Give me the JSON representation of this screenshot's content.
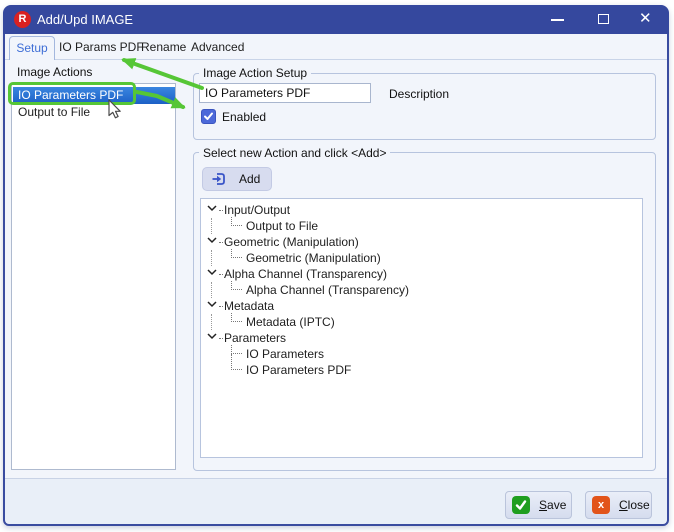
{
  "window": {
    "title": "Add/Upd IMAGE",
    "logo_letter": "R",
    "close_glyph": "✕"
  },
  "tabs": [
    {
      "label": "Setup",
      "active": true
    },
    {
      "label": "IO Params PDF",
      "active": false
    },
    {
      "label": "Rename",
      "active": false
    },
    {
      "label": "Advanced",
      "active": false
    }
  ],
  "left_panel": {
    "title": "Image Actions",
    "items": [
      {
        "label": "IO Parameters PDF",
        "selected": true
      },
      {
        "label": "Output to File",
        "selected": false
      }
    ]
  },
  "action_setup": {
    "group_title": "Image Action Setup",
    "name_value": "IO Parameters PDF",
    "description_label": "Description",
    "enabled_label": "Enabled",
    "enabled_checked": true
  },
  "add_section": {
    "group_title": "Select new Action  and click <Add>",
    "add_button_label": "Add",
    "tree": [
      {
        "label": "Input/Output",
        "type": "parent"
      },
      {
        "label": "Output to File",
        "type": "child"
      },
      {
        "label": "Geometric (Manipulation)",
        "type": "parent"
      },
      {
        "label": "Geometric (Manipulation)",
        "type": "child"
      },
      {
        "label": "Alpha Channel (Transparency)",
        "type": "parent"
      },
      {
        "label": "Alpha Channel (Transparency)",
        "type": "child"
      },
      {
        "label": "Metadata",
        "type": "parent"
      },
      {
        "label": "Metadata (IPTC)",
        "type": "child"
      },
      {
        "label": "Parameters",
        "type": "parent"
      },
      {
        "label": "IO Parameters",
        "type": "child-middle"
      },
      {
        "label": "IO Parameters PDF",
        "type": "child-last"
      }
    ]
  },
  "footer": {
    "save_label": "Save",
    "close_label": "Close"
  },
  "icons": {
    "app_logo": "letter-R-red-circle",
    "minimize": "line",
    "maximize": "square-outline",
    "close": "x",
    "add": "arrow-into-bracket",
    "save": "white-check-on-green",
    "close_btn": "white-x-on-orange",
    "enabled_checkbox": "white-check-on-blue",
    "tree_expanded": "chevron-down"
  },
  "colors": {
    "titlebar": "#35489E",
    "window_border": "#3A4CA0",
    "dialog_bg": "#F2F5FB",
    "selection_blue": "#2372D8",
    "annotation_green": "#56C636",
    "save_green": "#1F9E1F",
    "close_orange": "#E2541A",
    "accent_blue": "#3E6ED6",
    "logo_red": "#D92121"
  }
}
